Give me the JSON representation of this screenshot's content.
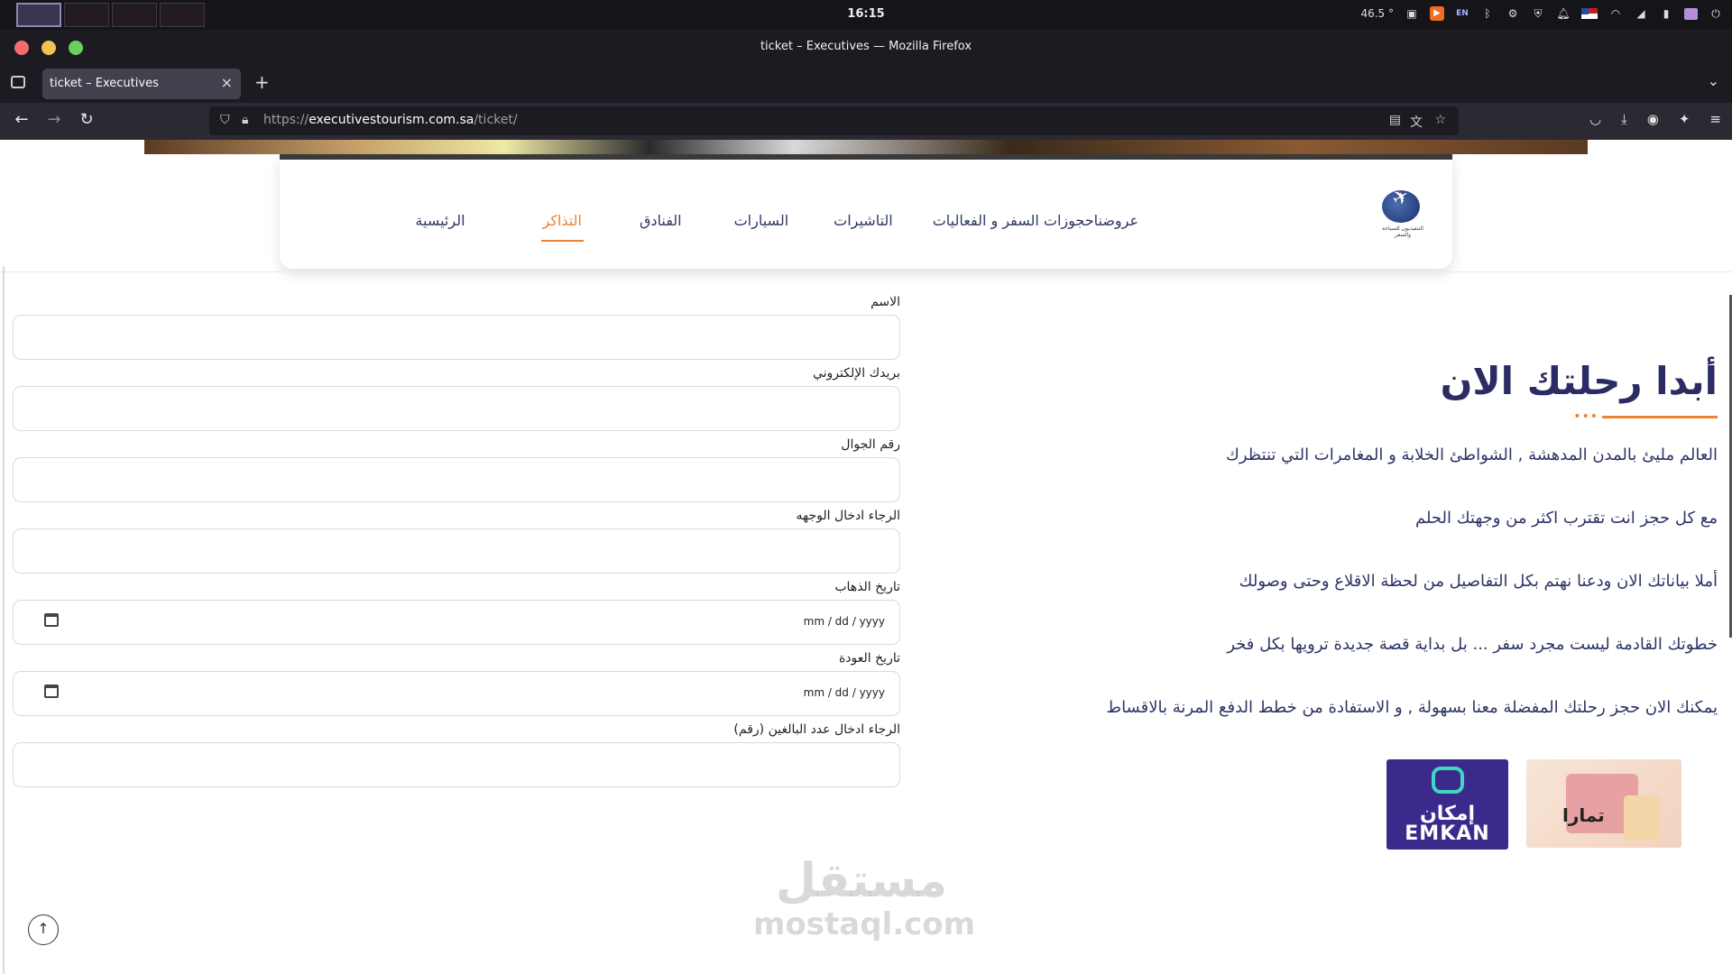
{
  "os": {
    "clock": "16:15",
    "temperature": "46.5 °",
    "keyboard_layout": "EN",
    "tray_icons": [
      "screenshot-icon",
      "app-indicator-icon",
      "keyboard-icon",
      "bluetooth-icon",
      "vpn-icon",
      "shield-icon",
      "bell-icon",
      "flag-us-icon",
      "wifi-icon",
      "volume-icon",
      "battery-icon",
      "folder-icon"
    ]
  },
  "browser": {
    "window_title": "ticket – Executives — Mozilla Firefox",
    "tab_title": "ticket – Executives",
    "url_scheme": "https://",
    "url_host": "executivestourism.com.sa",
    "url_path": "/ticket/"
  },
  "site": {
    "logo_text": "التنفيذيون للسياحة والسفر",
    "menu": [
      {
        "label": "الرئيسية",
        "active": false
      },
      {
        "label": "التذاكر",
        "active": true
      },
      {
        "label": "الفنادق",
        "active": false
      },
      {
        "label": "السيارات",
        "active": false
      },
      {
        "label": "التاشيرات",
        "active": false
      },
      {
        "label": "حجوزات السفر و الفعاليات",
        "active": false
      },
      {
        "label": "عروضنا",
        "active": false
      }
    ],
    "accent_color": "#f0822f",
    "heading_color": "#2a2c63"
  },
  "info": {
    "title": "أبدا رحلتك الان",
    "paragraphs": [
      "العالم مليئ بالمدن المدهشة , الشواطئ الخلابة و المغامرات التي تنتظرك",
      "مع كل حجز انت تقترب اكثر من وجهتك الحلم",
      "أملا بياناتك الان ودعنا نهتم بكل التفاصيل من لحظة الاقلاع وحتى وصولك",
      "خطوتك القادمة ليست مجرد سفر ... بل بداية قصة جديدة ترويها بكل فخر",
      "يمكنك الان حجز رحلتك المفضلة معنا بسهولة , و الاستفادة من خطط الدفع المرنة بالاقساط"
    ],
    "partners": {
      "emkan_ar": "إمكان",
      "emkan_en": "EMKAN",
      "tamara": "تمارا"
    }
  },
  "form": {
    "name_label": "الاسم",
    "name_value": "",
    "email_label": "بريدك الإلكتروني",
    "email_value": "",
    "phone_label": "رقم الجوال",
    "phone_value": "",
    "destination_label": "الرجاء ادخال الوجهه",
    "destination_value": "",
    "depart_label": "تاريخ الذهاب",
    "depart_placeholder": "mm / dd / yyyy",
    "return_label": "تاريخ العودة",
    "return_placeholder": "mm / dd / yyyy",
    "adults_label": "الرجاء ادخال عدد البالغين (رقم)",
    "adults_value": ""
  },
  "watermark": {
    "ar": "مستقل",
    "en": "mostaql.com"
  }
}
